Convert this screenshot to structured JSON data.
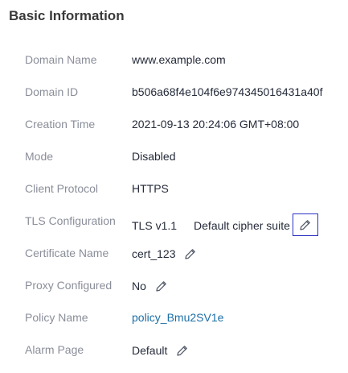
{
  "section": {
    "title": "Basic Information"
  },
  "fields": {
    "domain_name": {
      "label": "Domain Name",
      "value": "www.example.com"
    },
    "domain_id": {
      "label": "Domain ID",
      "value": "b506a68f4e104f6e974345016431a40f"
    },
    "creation_time": {
      "label": "Creation Time",
      "value": "2021-09-13 20:24:06 GMT+08:00"
    },
    "mode": {
      "label": "Mode",
      "value": "Disabled"
    },
    "client_protocol": {
      "label": "Client Protocol",
      "value": "HTTPS"
    },
    "tls_configuration": {
      "label": "TLS Configuration",
      "value": "TLS v1.1",
      "suite": "Default cipher suite"
    },
    "certificate_name": {
      "label": "Certificate Name",
      "value": "cert_123"
    },
    "proxy_configured": {
      "label": "Proxy Configured",
      "value": "No"
    },
    "policy_name": {
      "label": "Policy Name",
      "value": "policy_Bmu2SV1e"
    },
    "alarm_page": {
      "label": "Alarm Page",
      "value": "Default"
    }
  },
  "icons": {
    "edit": "pencil-icon"
  },
  "colors": {
    "label": "#8a8e99",
    "value": "#252b3a",
    "link": "#1d6fa5",
    "focus_border": "#2b33c4",
    "icon": "#575d6c"
  }
}
